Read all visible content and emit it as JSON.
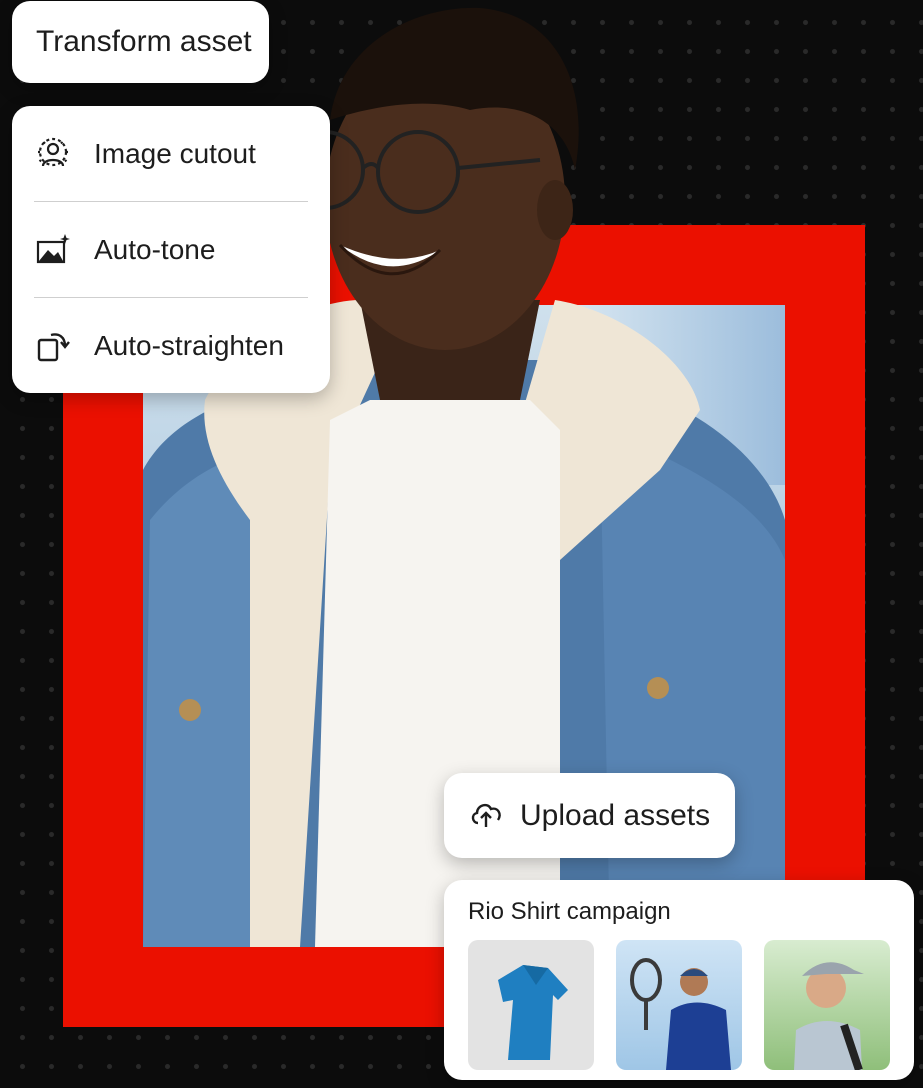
{
  "transform": {
    "label": "Transform asset"
  },
  "menu": {
    "items": [
      {
        "label": "Image cutout",
        "icon": "person-select-icon"
      },
      {
        "label": "Auto-tone",
        "icon": "image-sparkle-icon"
      },
      {
        "label": "Auto-straighten",
        "icon": "rotate-crop-icon"
      }
    ]
  },
  "upload": {
    "label": "Upload assets",
    "icon": "cloud-upload-icon"
  },
  "campaign": {
    "title": "Rio Shirt campaign",
    "thumbnails": [
      "blue-polo-shirt",
      "tennis-player",
      "man-in-cap"
    ]
  },
  "colors": {
    "accent_red": "#EB1000",
    "background": "#0C0C0C"
  }
}
